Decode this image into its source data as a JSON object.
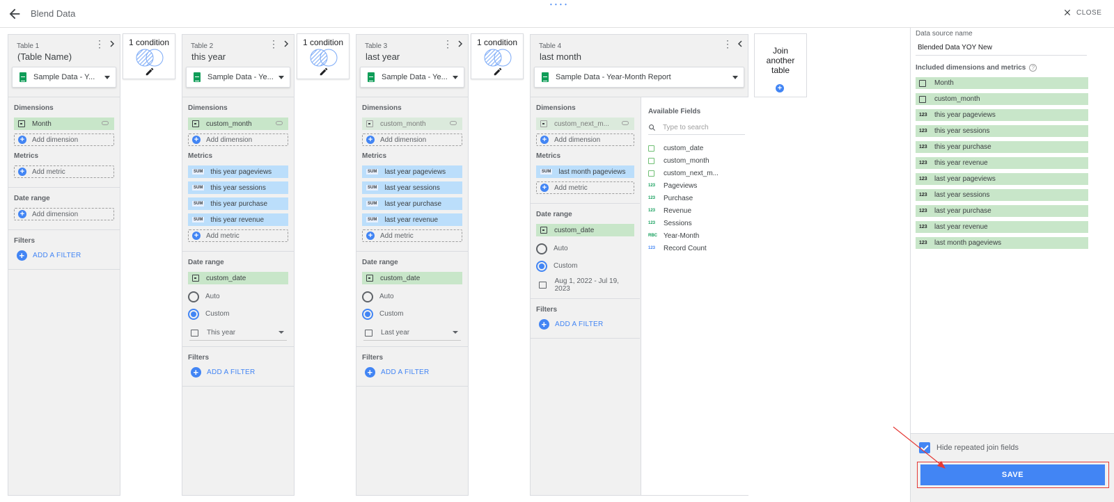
{
  "header": {
    "title": "Blend Data",
    "close_label": "CLOSE"
  },
  "tables": [
    {
      "label": "Table 1",
      "name": "(Table Name)",
      "source": "Sample Data - Y...",
      "dimensions": [
        {
          "name": "Month",
          "disabled": false
        }
      ],
      "dimension_add": "Add dimension",
      "metrics": [],
      "metric_add": "Add metric",
      "date_range_header": "Date range",
      "date_add": "Add dimension",
      "filters_header": "Filters",
      "filter_add": "ADD A FILTER"
    },
    {
      "label": "Table 2",
      "name": "this year",
      "source": "Sample Data - Ye...",
      "dimensions": [
        {
          "name": "custom_month",
          "disabled": false
        }
      ],
      "dimension_add": "Add dimension",
      "metrics": [
        "this year pageviews",
        "this year sessions",
        "this year purchase",
        "this year revenue"
      ],
      "metric_add": "Add metric",
      "date_range_header": "Date range",
      "date_field": "custom_date",
      "auto_label": "Auto",
      "custom_label": "Custom",
      "period": "This year",
      "filters_header": "Filters",
      "filter_add": "ADD A FILTER"
    },
    {
      "label": "Table 3",
      "name": "last year",
      "source": "Sample Data - Ye...",
      "dimensions": [
        {
          "name": "custom_month",
          "disabled": true
        }
      ],
      "dimension_add": "Add dimension",
      "metrics": [
        "last year pageviews",
        "last year sessions",
        "last year purchase",
        "last year revenue"
      ],
      "metric_add": "Add metric",
      "date_range_header": "Date range",
      "date_field": "custom_date",
      "auto_label": "Auto",
      "custom_label": "Custom",
      "period": "Last year",
      "filters_header": "Filters",
      "filter_add": "ADD A FILTER"
    },
    {
      "label": "Table 4",
      "name": "last month",
      "source": "Sample Data - Year-Month Report",
      "dimensions": [
        {
          "name": "custom_next_m...",
          "disabled": true
        }
      ],
      "dimension_add": "Add dimension",
      "metrics": [
        "last month pageviews"
      ],
      "metric_add": "Add metric",
      "date_range_header": "Date range",
      "date_field": "custom_date",
      "auto_label": "Auto",
      "custom_label": "Custom",
      "period": "Aug 1, 2022 - Jul 19, 2023",
      "filters_header": "Filters",
      "filter_add": "ADD A FILTER"
    }
  ],
  "section_labels": {
    "dimensions": "Dimensions",
    "metrics": "Metrics",
    "sum": "SUM"
  },
  "conditions": [
    "1 condition",
    "1 condition",
    "1 condition"
  ],
  "join": {
    "label_line1": "Join",
    "label_line2": "another",
    "label_line3": "table"
  },
  "available": {
    "header": "Available Fields",
    "search_placeholder": "Type to search",
    "fields": [
      {
        "name": "custom_date",
        "type": "date"
      },
      {
        "name": "custom_month",
        "type": "date"
      },
      {
        "name": "custom_next_m...",
        "type": "date"
      },
      {
        "name": "Pageviews",
        "type": "123"
      },
      {
        "name": "Purchase",
        "type": "123"
      },
      {
        "name": "Revenue",
        "type": "123"
      },
      {
        "name": "Sessions",
        "type": "123"
      },
      {
        "name": "Year-Month",
        "type": "ABC"
      },
      {
        "name": "Record Count",
        "type": "123b"
      }
    ]
  },
  "right": {
    "ds_label": "Data source name",
    "ds_name": "Blended Data YOY New",
    "included_label": "Included dimensions and metrics",
    "included": [
      {
        "name": "Month",
        "type": "date"
      },
      {
        "name": "custom_month",
        "type": "date"
      },
      {
        "name": "this year pageviews",
        "type": "123"
      },
      {
        "name": "this year sessions",
        "type": "123"
      },
      {
        "name": "this year purchase",
        "type": "123"
      },
      {
        "name": "this year revenue",
        "type": "123"
      },
      {
        "name": "last year pageviews",
        "type": "123"
      },
      {
        "name": "last year sessions",
        "type": "123"
      },
      {
        "name": "last year purchase",
        "type": "123"
      },
      {
        "name": "last year revenue",
        "type": "123"
      },
      {
        "name": "last month pageviews",
        "type": "123"
      }
    ],
    "num_icon": "123",
    "hide_label": "Hide repeated join fields",
    "save_label": "SAVE"
  },
  "colors": {
    "accent": "#4285f4",
    "dimension": "#c8e6c9",
    "metric": "#bbdefb",
    "highlight": "#e53935"
  }
}
